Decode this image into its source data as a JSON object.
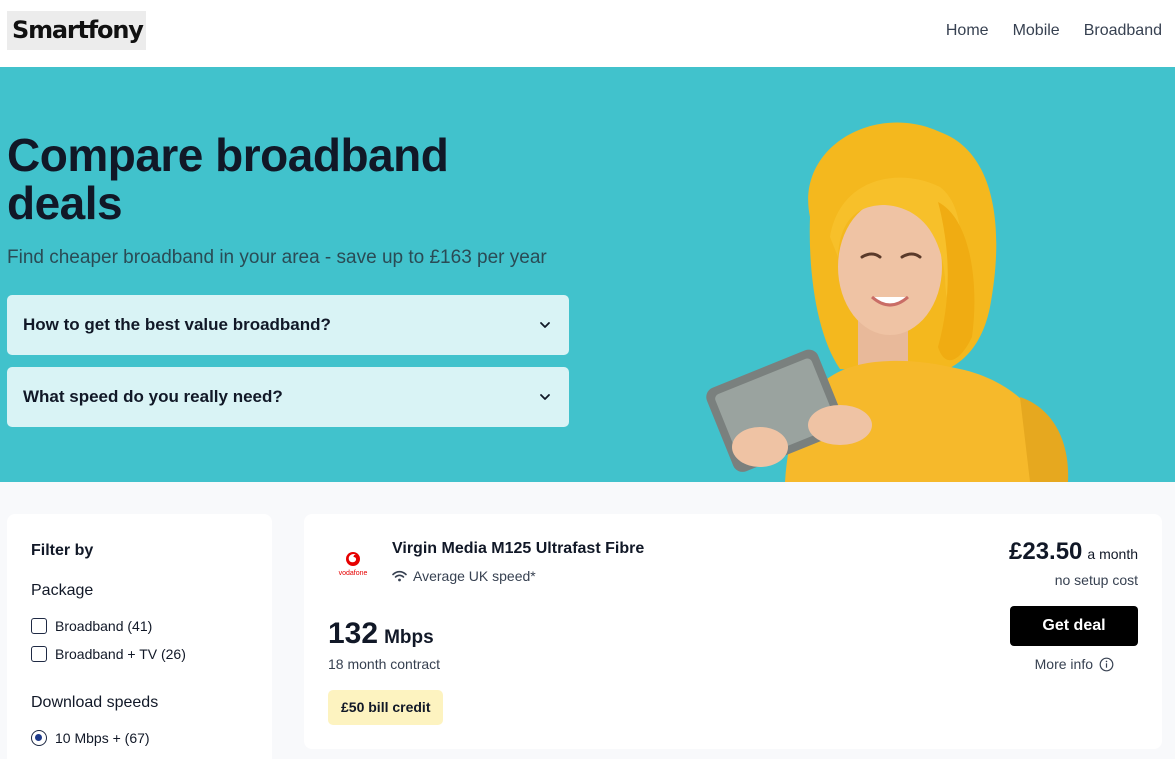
{
  "header": {
    "logo": "Smartfony",
    "nav": [
      "Home",
      "Mobile",
      "Broadband"
    ]
  },
  "hero": {
    "title": "Compare broadband deals",
    "subtitle": "Find cheaper broadband in your area - save up to £163 per year",
    "accordions": [
      {
        "label": "How to get the best value broadband?"
      },
      {
        "label": "What speed do you really need?"
      }
    ]
  },
  "filters": {
    "title": "Filter by",
    "package": {
      "title": "Package",
      "options": [
        {
          "label": "Broadband (41)",
          "checked": false
        },
        {
          "label": "Broadband + TV (26)",
          "checked": false
        }
      ]
    },
    "download_speeds": {
      "title": "Download speeds",
      "options": [
        {
          "label": "10 Mbps + (67)",
          "selected": true
        }
      ]
    }
  },
  "deal": {
    "brand_icon": "vodafone-logo",
    "brand_logo_text": "vodafone",
    "name": "Virgin Media M125 Ultrafast Fibre",
    "speed_note": "Average UK speed*",
    "speed": "132",
    "speed_unit": "Mbps",
    "contract": "18 month contract",
    "badge": "£50 bill credit",
    "price": "£23.50",
    "price_period": "a month",
    "setup": "no setup cost",
    "cta": "Get deal",
    "more_info": "More info"
  },
  "colors": {
    "hero_bg": "#41c2cc",
    "accordion_bg": "#d9f3f5",
    "badge_bg": "#fdf3c0",
    "cta_bg": "#000000",
    "brand_red": "#e60000"
  }
}
